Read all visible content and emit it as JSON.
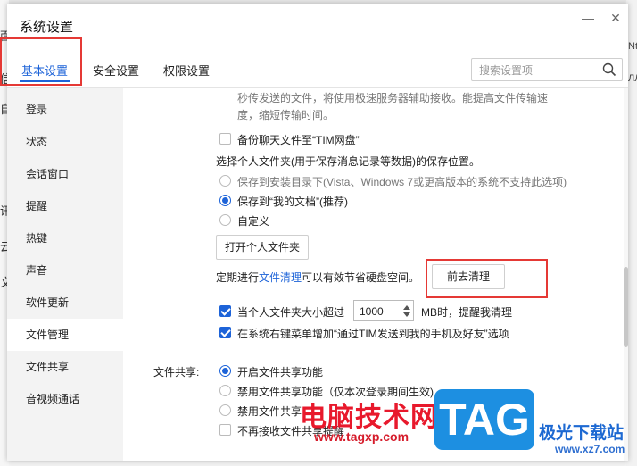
{
  "window": {
    "title": "系统设置",
    "minimize_glyph": "—",
    "close_glyph": "✕"
  },
  "background": {
    "left_chars": [
      "面",
      "信",
      "自",
      "讯",
      "云",
      "文"
    ],
    "right_chars": [
      "Nt",
      "ЛЛ"
    ]
  },
  "tabs": [
    {
      "label": "基本设置",
      "active": true
    },
    {
      "label": "安全设置",
      "active": false
    },
    {
      "label": "权限设置",
      "active": false
    }
  ],
  "search": {
    "placeholder": "搜索设置项",
    "value": "",
    "icon": "search-icon"
  },
  "sidebar": {
    "items": [
      {
        "label": "登录"
      },
      {
        "label": "状态"
      },
      {
        "label": "会话窗口"
      },
      {
        "label": "提醒"
      },
      {
        "label": "热键"
      },
      {
        "label": "声音"
      },
      {
        "label": "软件更新"
      },
      {
        "label": "文件管理",
        "active": true
      },
      {
        "label": "文件共享"
      },
      {
        "label": "音视频通话"
      }
    ]
  },
  "content": {
    "truncated_line1": "秒传发送的文件，将使用极速服务器辅助接收。能提高文件传输速",
    "truncated_line2": "度，缩短传输时间。",
    "backup_checkbox": {
      "label": "备份聊天文件至“TIM网盘”",
      "checked": false
    },
    "personal_folder_heading": "选择个人文件夹(用于保存消息记录等数据)的保存位置。",
    "location_options": [
      {
        "label": "保存到安装目录下(Vista、Windows 7或更高版本的系统不支持此选项)",
        "checked": false,
        "disabled": true
      },
      {
        "label": "保存到“我的文档”(推荐)",
        "checked": true,
        "disabled": false
      },
      {
        "label": "自定义",
        "checked": false,
        "disabled": false
      }
    ],
    "open_folder_button": "打开个人文件夹",
    "cleanup_prefix": "定期进行",
    "cleanup_link": "文件清理",
    "cleanup_suffix": "可以有效节省硬盘空间。",
    "cleanup_button": "前去清理",
    "size_limit": {
      "checked": true,
      "prefix": "当个人文件夹大小超过",
      "value": "1000",
      "suffix": "MB时，提醒我清理"
    },
    "context_menu": {
      "checked": true,
      "label": "在系统右键菜单增加“通过TIM发送到我的手机及好友”选项"
    },
    "file_share_label": "文件共享:",
    "file_share_options": [
      {
        "label": "开启文件共享功能",
        "checked": true
      },
      {
        "label": "禁用文件共享功能（仅本次登录期间生效)",
        "checked": false
      },
      {
        "label": "禁用文件共享",
        "checked": false
      }
    ],
    "no_receive": {
      "label": "不再接收文件共享提醒",
      "checked": false
    }
  },
  "watermark": {
    "text": "电脑技术网",
    "url": "www.tagxp.com",
    "badge": "TAG",
    "right_text": "极光下载站",
    "right_url": "www.xz7.com"
  },
  "colors": {
    "accent": "#1d63d8",
    "highlight_box": "#e53935",
    "watermark_red": "#e8192c",
    "watermark_blue": "#1d8fe1"
  }
}
